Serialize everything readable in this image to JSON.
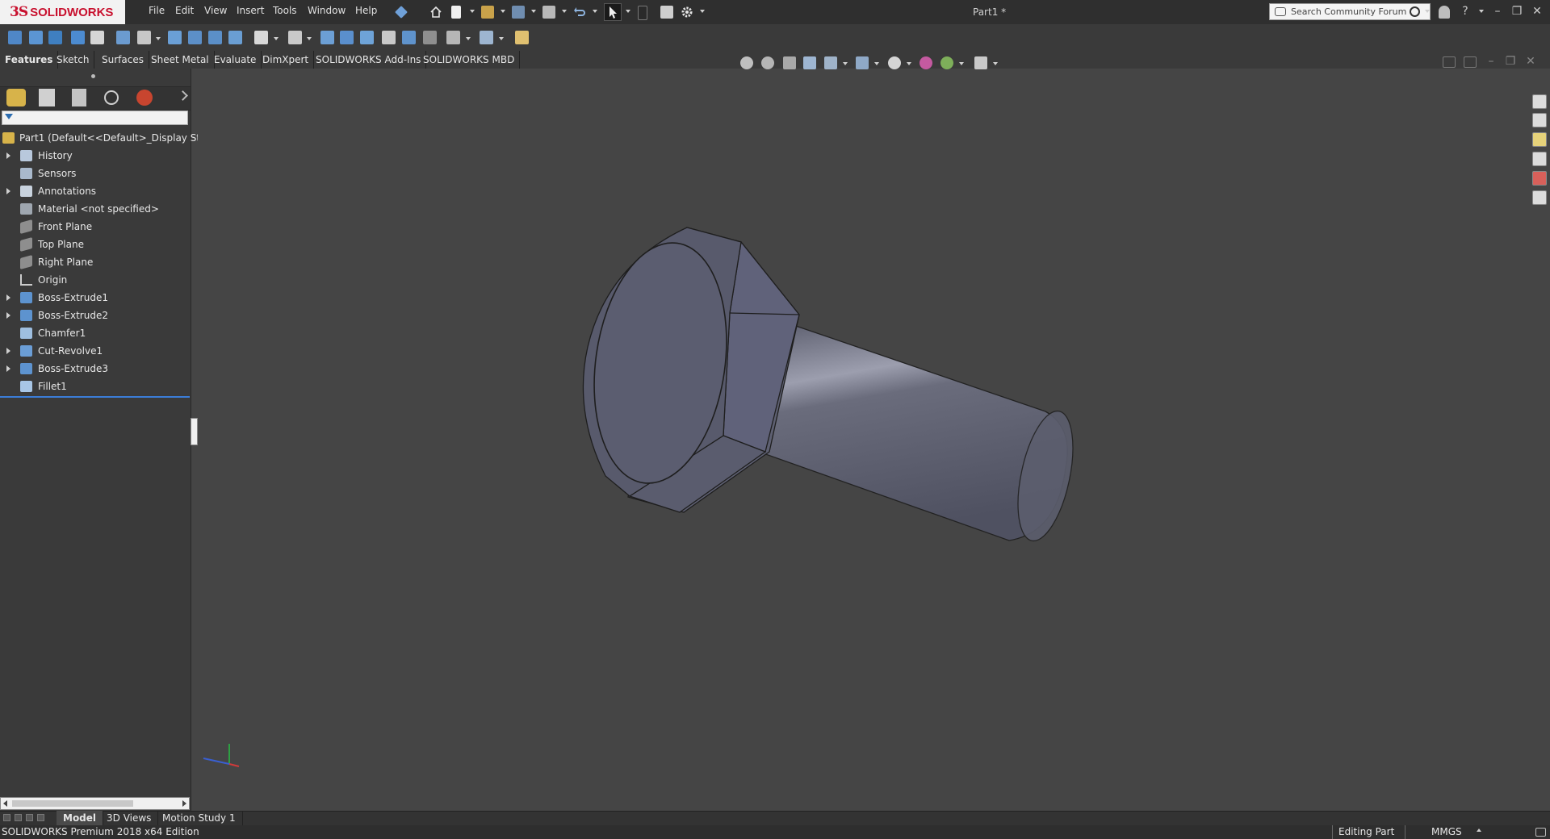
{
  "app": {
    "brand_ds": "3S",
    "brand_name": "SOLIDWORKS",
    "document_title": "Part1 *"
  },
  "menu": [
    "File",
    "Edit",
    "View",
    "Insert",
    "Tools",
    "Window",
    "Help"
  ],
  "search": {
    "placeholder": "Search Community Forum"
  },
  "command_tabs": [
    "Features",
    "Sketch",
    "Surfaces",
    "Sheet Metal",
    "Evaluate",
    "DimXpert",
    "SOLIDWORKS Add-Ins",
    "SOLIDWORKS MBD"
  ],
  "active_command_tab": "Features",
  "feature_tree": {
    "root": "Part1  (Default<<Default>_Display State",
    "items": [
      {
        "label": "History",
        "expandable": true,
        "icon": "history-icon"
      },
      {
        "label": "Sensors",
        "expandable": false,
        "icon": "sensors-icon"
      },
      {
        "label": "Annotations",
        "expandable": true,
        "icon": "annotations-icon"
      },
      {
        "label": "Material <not specified>",
        "expandable": false,
        "icon": "material-icon"
      },
      {
        "label": "Front Plane",
        "expandable": false,
        "icon": "plane-icon"
      },
      {
        "label": "Top Plane",
        "expandable": false,
        "icon": "plane-icon"
      },
      {
        "label": "Right Plane",
        "expandable": false,
        "icon": "plane-icon"
      },
      {
        "label": "Origin",
        "expandable": false,
        "icon": "origin-icon"
      },
      {
        "label": "Boss-Extrude1",
        "expandable": true,
        "icon": "extrude-icon"
      },
      {
        "label": "Boss-Extrude2",
        "expandable": true,
        "icon": "extrude-icon"
      },
      {
        "label": "Chamfer1",
        "expandable": false,
        "icon": "chamfer-icon"
      },
      {
        "label": "Cut-Revolve1",
        "expandable": true,
        "icon": "revolve-icon"
      },
      {
        "label": "Boss-Extrude3",
        "expandable": true,
        "icon": "extrude-icon"
      },
      {
        "label": "Fillet1",
        "expandable": false,
        "icon": "fillet-icon"
      }
    ]
  },
  "bottom_tabs": [
    "Model",
    "3D Views",
    "Motion Study 1"
  ],
  "active_bottom_tab": "Model",
  "status": {
    "edition": "SOLIDWORKS Premium 2018 x64 Edition",
    "mode": "Editing Part",
    "units": "MMGS"
  },
  "colors": {
    "background": "#454545",
    "panel": "#3a3a3a",
    "accent_blue": "#3b7dd8",
    "brand_red": "#c8102e",
    "model_face": "#5d5f70"
  }
}
